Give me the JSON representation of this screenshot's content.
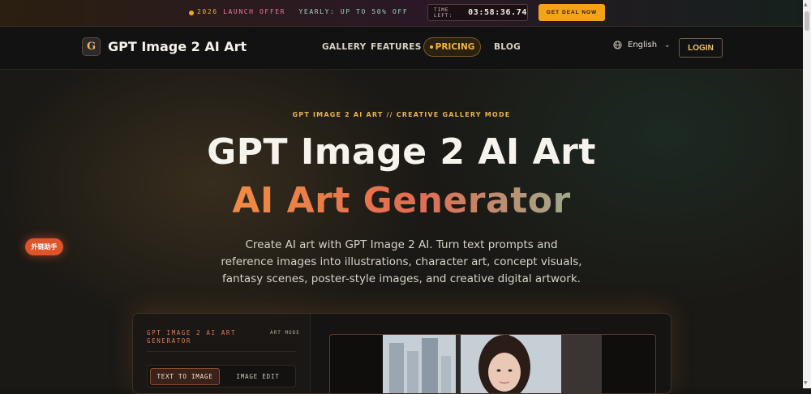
{
  "promo": {
    "year": "2026",
    "launch": "LAUNCH OFFER",
    "yearly": "YEARLY: UP TO 50% OFF",
    "timer_label": "TIME LEFT:",
    "timer_value": "03:58:36.74",
    "deal_button": "GET DEAL NOW"
  },
  "nav": {
    "logo_letter": "G",
    "brand": "GPT Image 2 AI Art",
    "links": [
      "GALLERY",
      "FEATURES",
      "PRICING",
      "BLOG"
    ],
    "language": "English",
    "login": "LOGIN"
  },
  "hero": {
    "eyebrow": "GPT IMAGE 2 AI ART // CREATIVE GALLERY MODE",
    "title_line1": "GPT Image 2 AI Art",
    "title_line2": "AI Art Generator",
    "description": "Create AI art with GPT Image 2 AI. Turn text prompts and reference images into illustrations, character art, concept visuals, fantasy scenes, poster-style images, and creative digital artwork."
  },
  "assistant_button": "外链助手",
  "generator": {
    "title": "GPT IMAGE 2 AI ART GENERATOR",
    "mode": "ART MODE",
    "tabs": [
      "TEXT TO IMAGE",
      "IMAGE EDIT"
    ],
    "active_tab": "TEXT TO IMAGE"
  },
  "colors": {
    "accent": "#f5a316",
    "title_gradient": [
      "#f2b53c",
      "#f08a44",
      "#e36b52",
      "#7fc7a4",
      "#58c7b8"
    ],
    "panel_border": "#3a3228"
  },
  "icons": {
    "promo_dot": "dot-icon",
    "language": "globe-icon",
    "dropdown": "chevron-down-icon"
  }
}
